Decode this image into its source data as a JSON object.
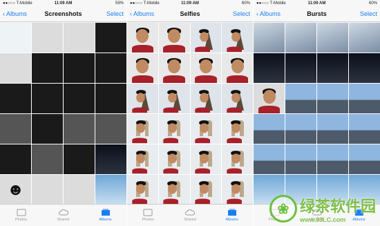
{
  "panels": [
    {
      "status": {
        "carrier": "●●○○○ T-Mobile",
        "time": "11:09 AM",
        "battery": "59%"
      },
      "back_label": "Albums",
      "title": "Screenshots",
      "select_label": "Select"
    },
    {
      "status": {
        "carrier": "●●○○○ T-Mobile",
        "time": "11:09 AM",
        "battery": "60%"
      },
      "back_label": "Albums",
      "title": "Selfies",
      "select_label": "Select"
    },
    {
      "status": {
        "carrier": "●●○○○ T-Mobile",
        "time": "11:09 AM",
        "battery": "60%"
      },
      "back_label": "Albums",
      "title": "Bursts",
      "select_label": "Select"
    }
  ],
  "tabs": {
    "photos": "Photos",
    "shared": "Shared",
    "albums": "Albums"
  },
  "icons": {
    "back": "chevron-left-icon",
    "photos_tab": "photos-icon",
    "shared_tab": "cloud-icon",
    "albums_tab": "albums-icon"
  },
  "colors": {
    "accent": "#1a7ef5",
    "watermark": "#7fbf4a"
  },
  "watermark": {
    "title": "绿茶软件园",
    "url": "www.33LC.com"
  }
}
